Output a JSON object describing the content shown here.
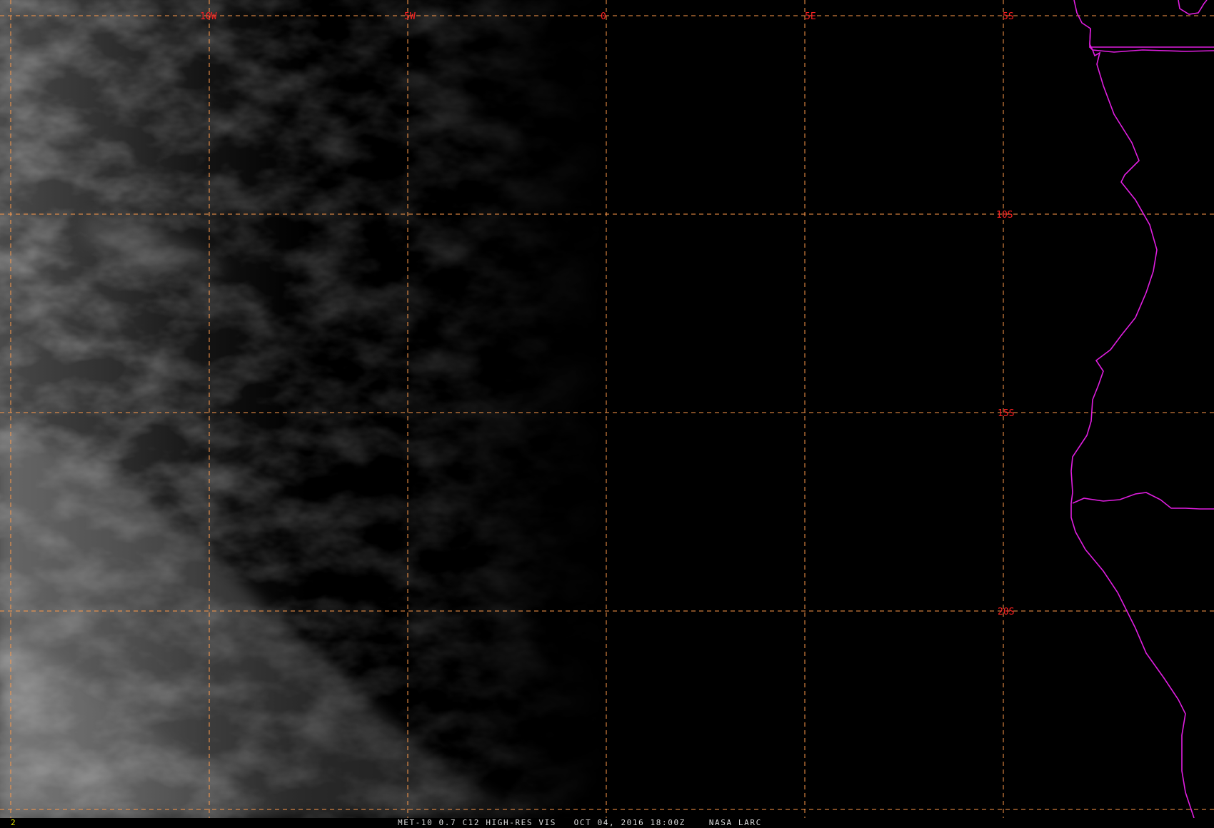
{
  "image": {
    "frame_number": "2",
    "caption": "MET-10 0.7 C12 HIGH-RES VIS   OCT 04, 2016 18:00Z    NASA LARC"
  },
  "grid": {
    "longitude_labels": [
      "10W",
      "5W",
      "0",
      "5E"
    ],
    "latitude_labels": [
      "5S",
      "10S",
      "15S",
      "20S"
    ]
  },
  "colors": {
    "grid_line": "#ff9a4a",
    "grid_label": "#ff2222",
    "coastline": "#e01ee0",
    "frame_number": "#e6e600",
    "caption": "#dcdcdc"
  }
}
